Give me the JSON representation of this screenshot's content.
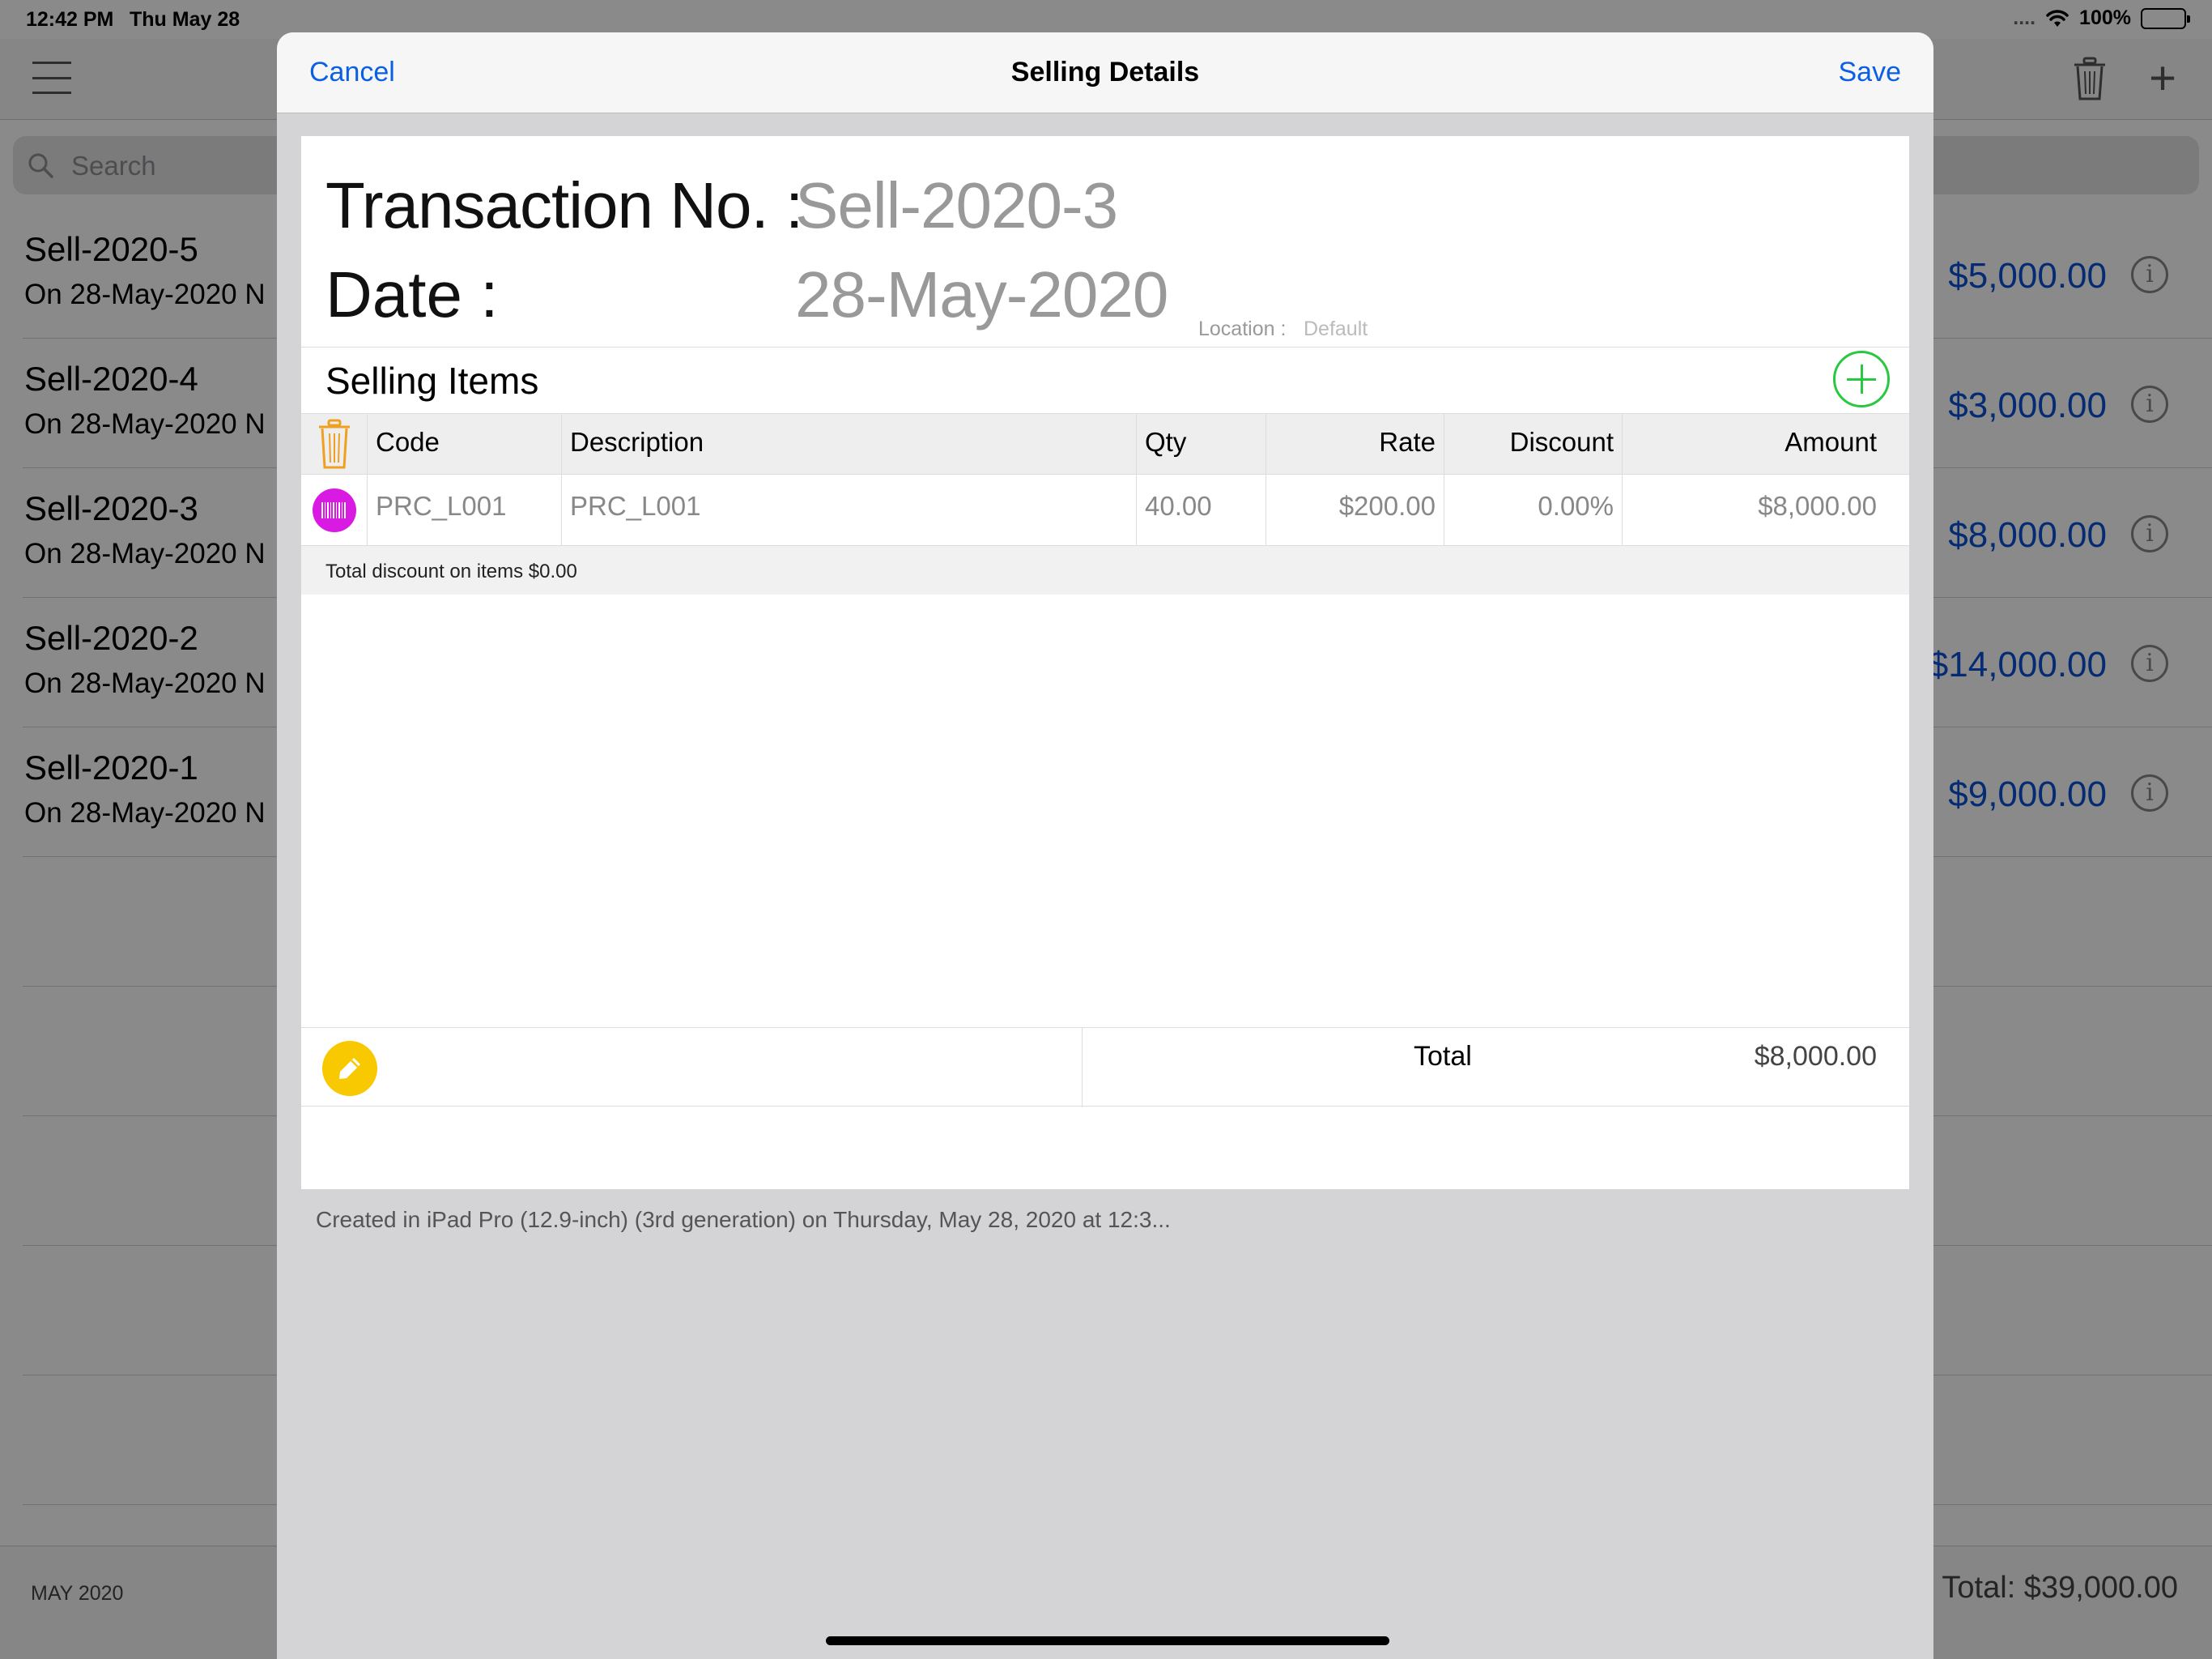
{
  "status": {
    "time": "12:42 PM",
    "date": "Thu May 28",
    "dots": "....",
    "battery": "100%"
  },
  "search": {
    "placeholder": "Search"
  },
  "list": {
    "rows": [
      {
        "title": "Sell-2020-5",
        "subtitle": "On 28-May-2020  N",
        "amount": "$5,000.00"
      },
      {
        "title": "Sell-2020-4",
        "subtitle": "On 28-May-2020  N",
        "amount": "$3,000.00"
      },
      {
        "title": "Sell-2020-3",
        "subtitle": "On 28-May-2020  N",
        "amount": "$8,000.00"
      },
      {
        "title": "Sell-2020-2",
        "subtitle": "On 28-May-2020  N",
        "amount": "$14,000.00"
      },
      {
        "title": "Sell-2020-1",
        "subtitle": "On 28-May-2020  N",
        "amount": "$9,000.00"
      }
    ],
    "info_glyph": "i"
  },
  "footer": {
    "month": "MAY 2020",
    "total": "Total: $39,000.00"
  },
  "modal": {
    "cancel": "Cancel",
    "title": "Selling Details",
    "save": "Save",
    "transaction_label": "Transaction No. :",
    "transaction_value": "Sell-2020-3",
    "date_label": "Date :",
    "date_value": "28-May-2020",
    "location_label": "Location :",
    "location_value": "Default",
    "items_title": "Selling Items",
    "table": {
      "headers": {
        "code": "Code",
        "description": "Description",
        "qty": "Qty",
        "rate": "Rate",
        "discount": "Discount",
        "amount": "Amount"
      },
      "rows": [
        {
          "code": "PRC_L001",
          "description": "PRC_L001",
          "qty": "40.00",
          "rate": "$200.00",
          "discount": "0.00%",
          "amount": "$8,000.00"
        }
      ]
    },
    "discount_note": "Total discount on items $0.00",
    "total_label": "Total",
    "total_value": "$8,000.00",
    "created_note": "Created in iPad Pro (12.9-inch) (3rd generation) on Thursday, May 28, 2020 at 12:3..."
  },
  "icons": {
    "menu": "hamburger-icon",
    "trash": "trash-icon",
    "add": "plus-icon",
    "search": "magnifier-icon",
    "info": "info-circle-icon",
    "barcode": "barcode-icon",
    "note": "pencil-icon"
  },
  "colors": {
    "accent_blue": "#0a60e0",
    "amount_blue": "#0a50d6",
    "add_green": "#28c840",
    "trash_orange": "#f0a020",
    "barcode_magenta": "#d91ae3",
    "note_yellow": "#f8c800"
  }
}
